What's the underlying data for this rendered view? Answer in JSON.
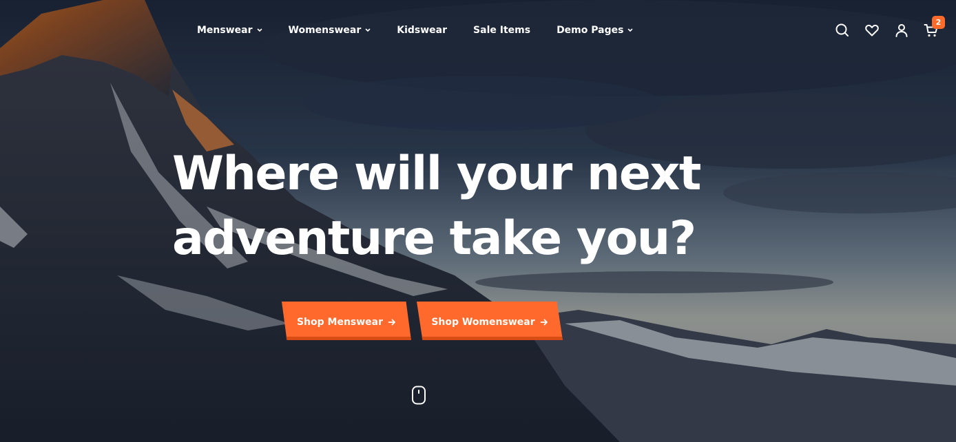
{
  "nav": {
    "items": [
      {
        "label": "Menswear",
        "has_dropdown": true
      },
      {
        "label": "Womenswear",
        "has_dropdown": true
      },
      {
        "label": "Kidswear",
        "has_dropdown": false
      },
      {
        "label": "Sale Items",
        "has_dropdown": false
      },
      {
        "label": "Demo Pages",
        "has_dropdown": true
      }
    ]
  },
  "header_icons": {
    "search": "search-icon",
    "wishlist": "heart-icon",
    "account": "user-icon",
    "cart": "cart-icon",
    "cart_count": "2"
  },
  "hero": {
    "headline_line1": "Where will your next",
    "headline_line2": "adventure take you?",
    "cta_primary": "Shop Menswear",
    "cta_secondary": "Shop Womenswear",
    "scroll_icon": "mouse-scroll-icon"
  },
  "colors": {
    "accent": "#ff6a2c",
    "accent_dark": "#d94d14",
    "badge": "#ff6b2b",
    "text": "#ffffff"
  }
}
